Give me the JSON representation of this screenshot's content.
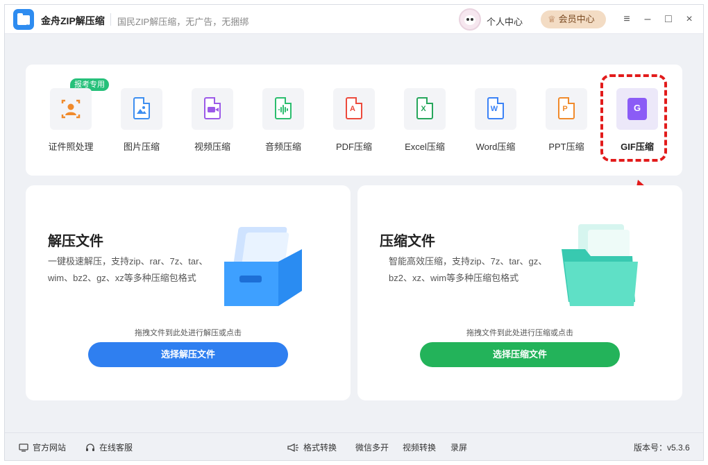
{
  "titlebar": {
    "app_title": "金舟ZIP解压缩",
    "subtitle": "国民ZIP解压缩，无广告，无捆绑",
    "user_center": "个人中心",
    "vip_center": "会员中心",
    "menu_icon": "≡",
    "minimize_icon": "–",
    "maximize_icon": "□",
    "close_icon": "×"
  },
  "tools": {
    "badge": "报考专用",
    "items": [
      {
        "label": "证件照处理",
        "icon": "id-photo-icon",
        "color": "#f08a2b"
      },
      {
        "label": "图片压缩",
        "icon": "image-icon",
        "color": "#3d8ef0"
      },
      {
        "label": "视频压缩",
        "icon": "video-icon",
        "color": "#9b59e8"
      },
      {
        "label": "音频压缩",
        "icon": "audio-icon",
        "color": "#2bbd6e"
      },
      {
        "label": "PDF压缩",
        "icon": "pdf-icon",
        "color": "#ec4a3c"
      },
      {
        "label": "Excel压缩",
        "icon": "excel-icon",
        "color": "#26a65b"
      },
      {
        "label": "Word压缩",
        "icon": "word-icon",
        "color": "#3b82f6"
      },
      {
        "label": "PPT压缩",
        "icon": "ppt-icon",
        "color": "#f08a2b"
      },
      {
        "label": "GIF压缩",
        "icon": "gif-icon",
        "color": "#8b5cf6"
      }
    ],
    "gif_letter": "G",
    "pdf_glyph": "A",
    "excel_glyph": "X",
    "word_glyph": "W",
    "ppt_glyph": "P"
  },
  "extract": {
    "title": "解压文件",
    "description": "一键极速解压，支持zip、rar、7z、tar、wim、bz2、gz、xz等多种压缩包格式",
    "hint": "拖拽文件到此处进行解压或点击",
    "button": "选择解压文件"
  },
  "compress": {
    "title": "压缩文件",
    "description": "智能高效压缩，支持zip、7z、tar、gz、bz2、xz、wim等多种压缩包格式",
    "hint": "拖拽文件到此处进行压缩或点击",
    "button": "选择压缩文件"
  },
  "statusbar": {
    "website": "官方网站",
    "service": "在线客服",
    "format_convert": "格式转换",
    "wechat_multi": "微信多开",
    "video_convert": "视频转换",
    "record": "录屏",
    "version": "版本号：v5.3.6"
  },
  "colors": {
    "accent_blue": "#2f7ff0",
    "accent_green": "#23b35a",
    "highlight_red": "#e21b1b"
  }
}
